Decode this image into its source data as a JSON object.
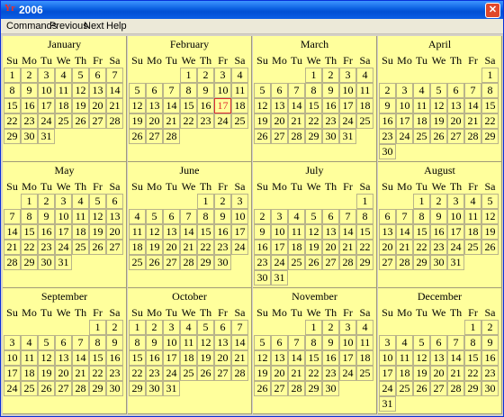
{
  "window": {
    "title": "2006",
    "app_icon": "app-icon",
    "close_label": "✕"
  },
  "menu": [
    "Commands",
    "Previous",
    "Next",
    "Help"
  ],
  "weekdays": [
    "Su",
    "Mo",
    "Tu",
    "We",
    "Th",
    "Fr",
    "Sa"
  ],
  "months": [
    {
      "name": "January",
      "start": 0,
      "days": 31
    },
    {
      "name": "February",
      "start": 3,
      "days": 28,
      "today": 17
    },
    {
      "name": "March",
      "start": 3,
      "days": 31
    },
    {
      "name": "April",
      "start": 6,
      "days": 30
    },
    {
      "name": "May",
      "start": 1,
      "days": 31
    },
    {
      "name": "June",
      "start": 4,
      "days": 30
    },
    {
      "name": "July",
      "start": 6,
      "days": 31
    },
    {
      "name": "August",
      "start": 2,
      "days": 31
    },
    {
      "name": "September",
      "start": 5,
      "days": 30
    },
    {
      "name": "October",
      "start": 0,
      "days": 31
    },
    {
      "name": "November",
      "start": 3,
      "days": 30
    },
    {
      "name": "December",
      "start": 5,
      "days": 31
    }
  ],
  "colors": {
    "cell_bg": "#ffff9c",
    "today": "#e03030"
  }
}
